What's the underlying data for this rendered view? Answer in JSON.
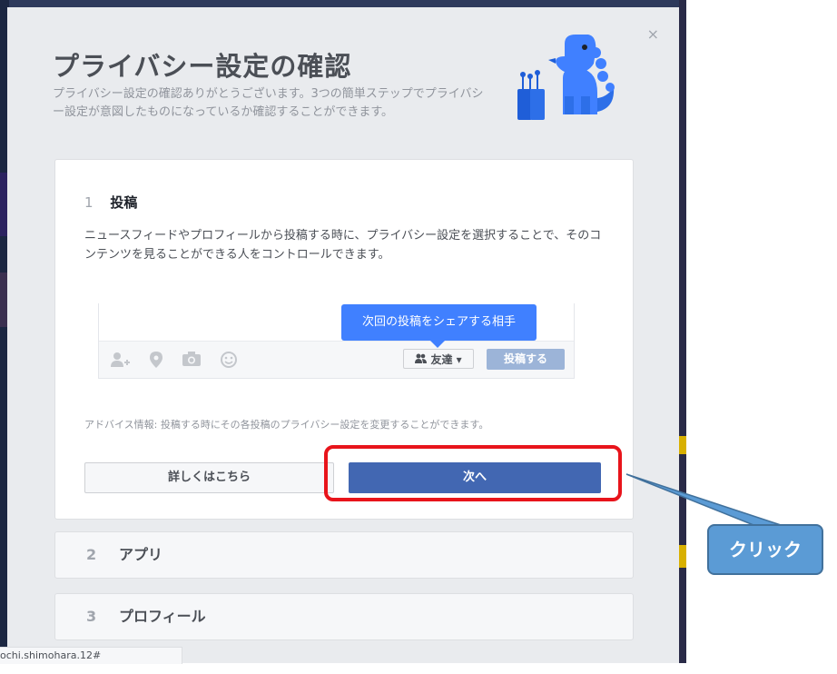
{
  "dialog": {
    "title": "プライバシー設定の確認",
    "subtitle": "プライバシー設定の確認ありがとうございます。3つの簡単ステップでプライバシー設定が意図したものになっているか確認することができます。",
    "close_icon": "×"
  },
  "step1": {
    "number": "1",
    "title": "投稿",
    "description": "ニュースフィードやプロフィールから投稿する時に、プライバシー設定を選択することで、そのコンテンツを見ることができる人をコントロールできます。",
    "tooltip": "次回の投稿をシェアする相手",
    "audience_label": "友達",
    "post_button": "投稿する",
    "advice": "アドバイス情報: 投稿する時にその各投稿のプライバシー設定を変更することができます。",
    "more_button": "詳しくはこちら",
    "next_button": "次へ"
  },
  "steps": [
    {
      "number": "2",
      "label": "アプリ"
    },
    {
      "number": "3",
      "label": "プロフィール"
    }
  ],
  "status_tab": "ochi.shimohara.12#",
  "annotation": {
    "callout_label": "クリック",
    "highlight_color": "#e8141b",
    "callout_color": "#5b9bd5"
  },
  "colors": {
    "primary": "#4267b2",
    "tooltip": "#4080ff",
    "mascot": "#4080ff"
  },
  "icons": [
    "tag-friends-icon",
    "location-icon",
    "camera-icon",
    "smiley-icon",
    "friends-icon",
    "caret-down-icon",
    "close-icon",
    "privacy-dinosaur-icon"
  ]
}
